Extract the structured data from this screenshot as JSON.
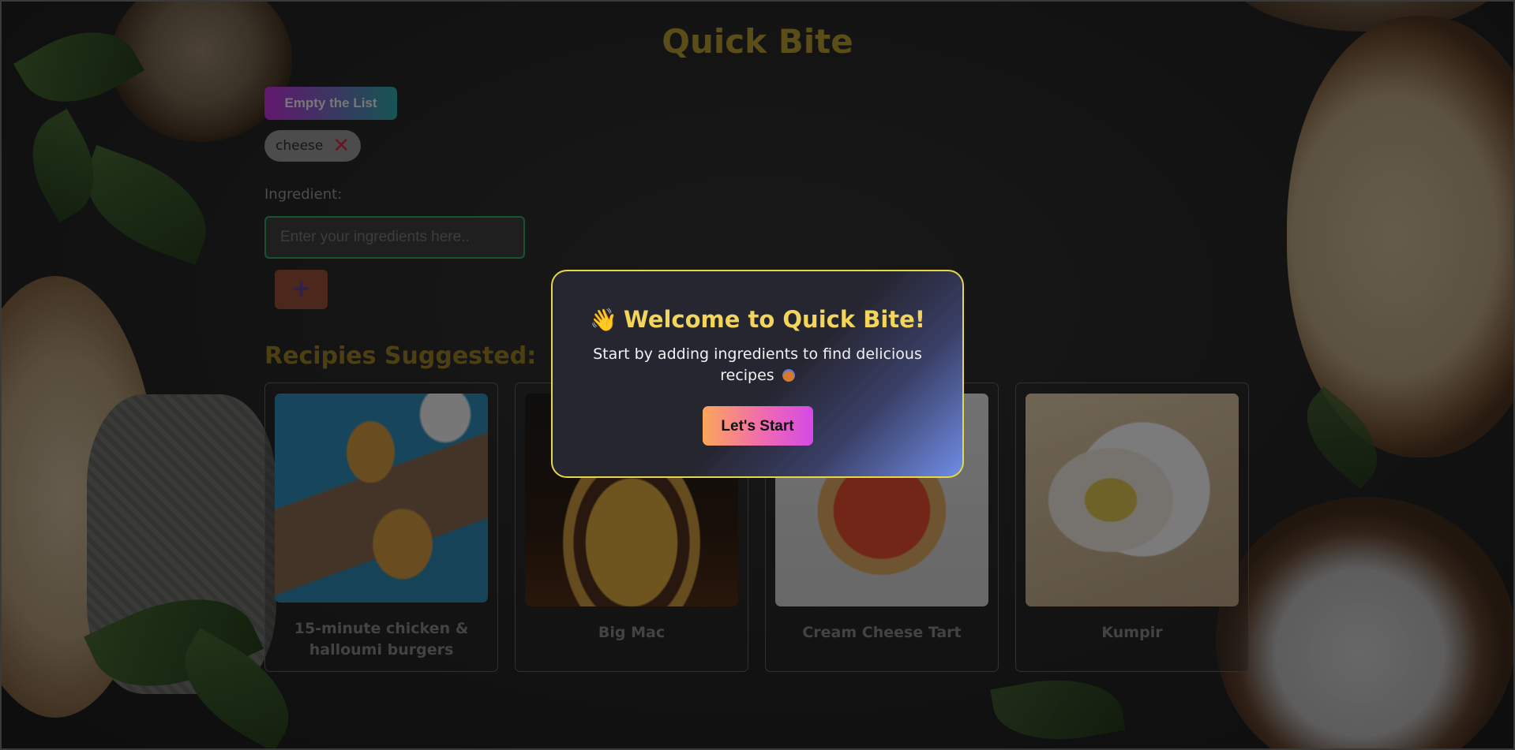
{
  "app": {
    "title": "Quick Bite"
  },
  "toolbar": {
    "empty_label": "Empty the List"
  },
  "ingredients": [
    {
      "name": "cheese",
      "remove_icon": "close-icon"
    }
  ],
  "form": {
    "label": "Ingredient:",
    "placeholder": "Enter your ingredients here..",
    "add_label": "+"
  },
  "recipes": {
    "heading": "Recipies Suggested:",
    "items": [
      {
        "name": "15-minute chicken & halloumi burgers"
      },
      {
        "name": "Big Mac"
      },
      {
        "name": "Cream Cheese Tart"
      },
      {
        "name": "Kumpir"
      }
    ]
  },
  "modal": {
    "title": "Welcome to Quick Bite!",
    "title_icon": "👋",
    "body": "Start by adding ingredients to find delicious recipes",
    "cta": "Let's Start"
  },
  "colors": {
    "title": "#a68c2a",
    "modal_border": "#e6d64a",
    "modal_title": "#f2d55a",
    "input_border": "#2a9a5a"
  }
}
